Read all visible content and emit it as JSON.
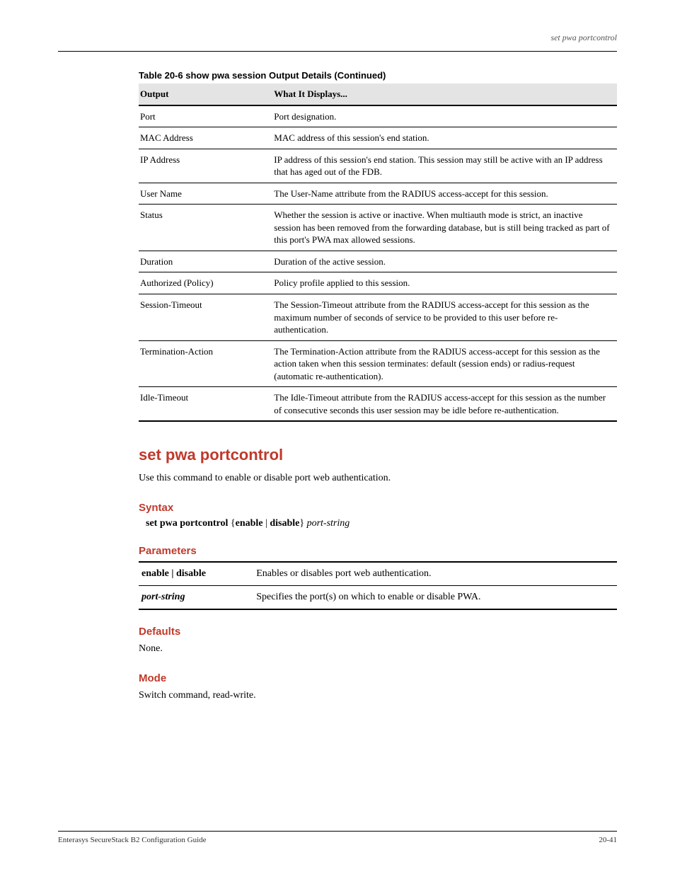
{
  "running_head": "set pwa portcontrol",
  "table": {
    "caption": "Table 20-6  show pwa session Output Details (Continued)",
    "col1": "Output",
    "col2": "What It Displays...",
    "rows": [
      {
        "output": "Port",
        "meaning": "Port designation.",
        "top_rule": "thick",
        "bottom_rule": "thin"
      },
      {
        "output": "MAC Address",
        "meaning": "MAC address of this session's end station.",
        "top_rule": "",
        "bottom_rule": "thin"
      },
      {
        "output": "IP Address",
        "meaning": "IP address of this session's end station. This session may still be active with an IP address that has aged out of the FDB.",
        "top_rule": "",
        "bottom_rule": "thin"
      },
      {
        "output": "User Name",
        "meaning": "The User-Name attribute from the RADIUS access-accept for this session.",
        "top_rule": "",
        "bottom_rule": "thin"
      },
      {
        "output": "Status",
        "meaning": "Whether the session is active or inactive. When multiauth mode is strict, an inactive session has been removed from the forwarding database, but is still being tracked as part of this port's PWA max allowed sessions.",
        "top_rule": "",
        "bottom_rule": "thin"
      },
      {
        "output": "Duration",
        "meaning": "Duration of the active session.",
        "top_rule": "",
        "bottom_rule": "thin"
      },
      {
        "output": "Authorized (Policy)",
        "meaning": "Policy profile applied to this session.",
        "top_rule": "",
        "bottom_rule": "thin"
      },
      {
        "output": "Session-Timeout",
        "meaning": "The Session-Timeout attribute from the RADIUS access-accept for this session as the maximum number of seconds of service to be provided to this user before re-authentication.",
        "top_rule": "",
        "bottom_rule": "thin"
      },
      {
        "output": "Termination-Action",
        "meaning": "The Termination-Action attribute from the RADIUS access-accept for this session as the action taken when this session terminates: default (session ends) or radius-request (automatic re-authentication).",
        "top_rule": "",
        "bottom_rule": "thin"
      },
      {
        "output": "Idle-Timeout",
        "meaning": "The Idle-Timeout attribute from the RADIUS access-accept for this session as the number of consecutive seconds this user session may be idle before re-authentication.",
        "top_rule": "",
        "bottom_rule": "thick"
      }
    ]
  },
  "command": {
    "name": "set pwa portcontrol",
    "description": "Use this command to enable or disable port web authentication.",
    "syntax_heading": "Syntax",
    "syntax_plain": "set pwa portcontrol {enable | disable} port-string",
    "parameters_heading": "Parameters",
    "parameters": [
      {
        "name_html": "enable | disable",
        "desc": "Enables or disables port web authentication."
      },
      {
        "name_html": "port-string",
        "desc": "Specifies the port(s) on which to enable or disable PWA."
      }
    ],
    "defaults_heading": "Defaults",
    "defaults_text": "None.",
    "mode_heading": "Mode",
    "mode_text": "Switch command, read-write."
  },
  "footer": {
    "left": "Enterasys SecureStack B2 Configuration Guide",
    "right": "20-41"
  }
}
